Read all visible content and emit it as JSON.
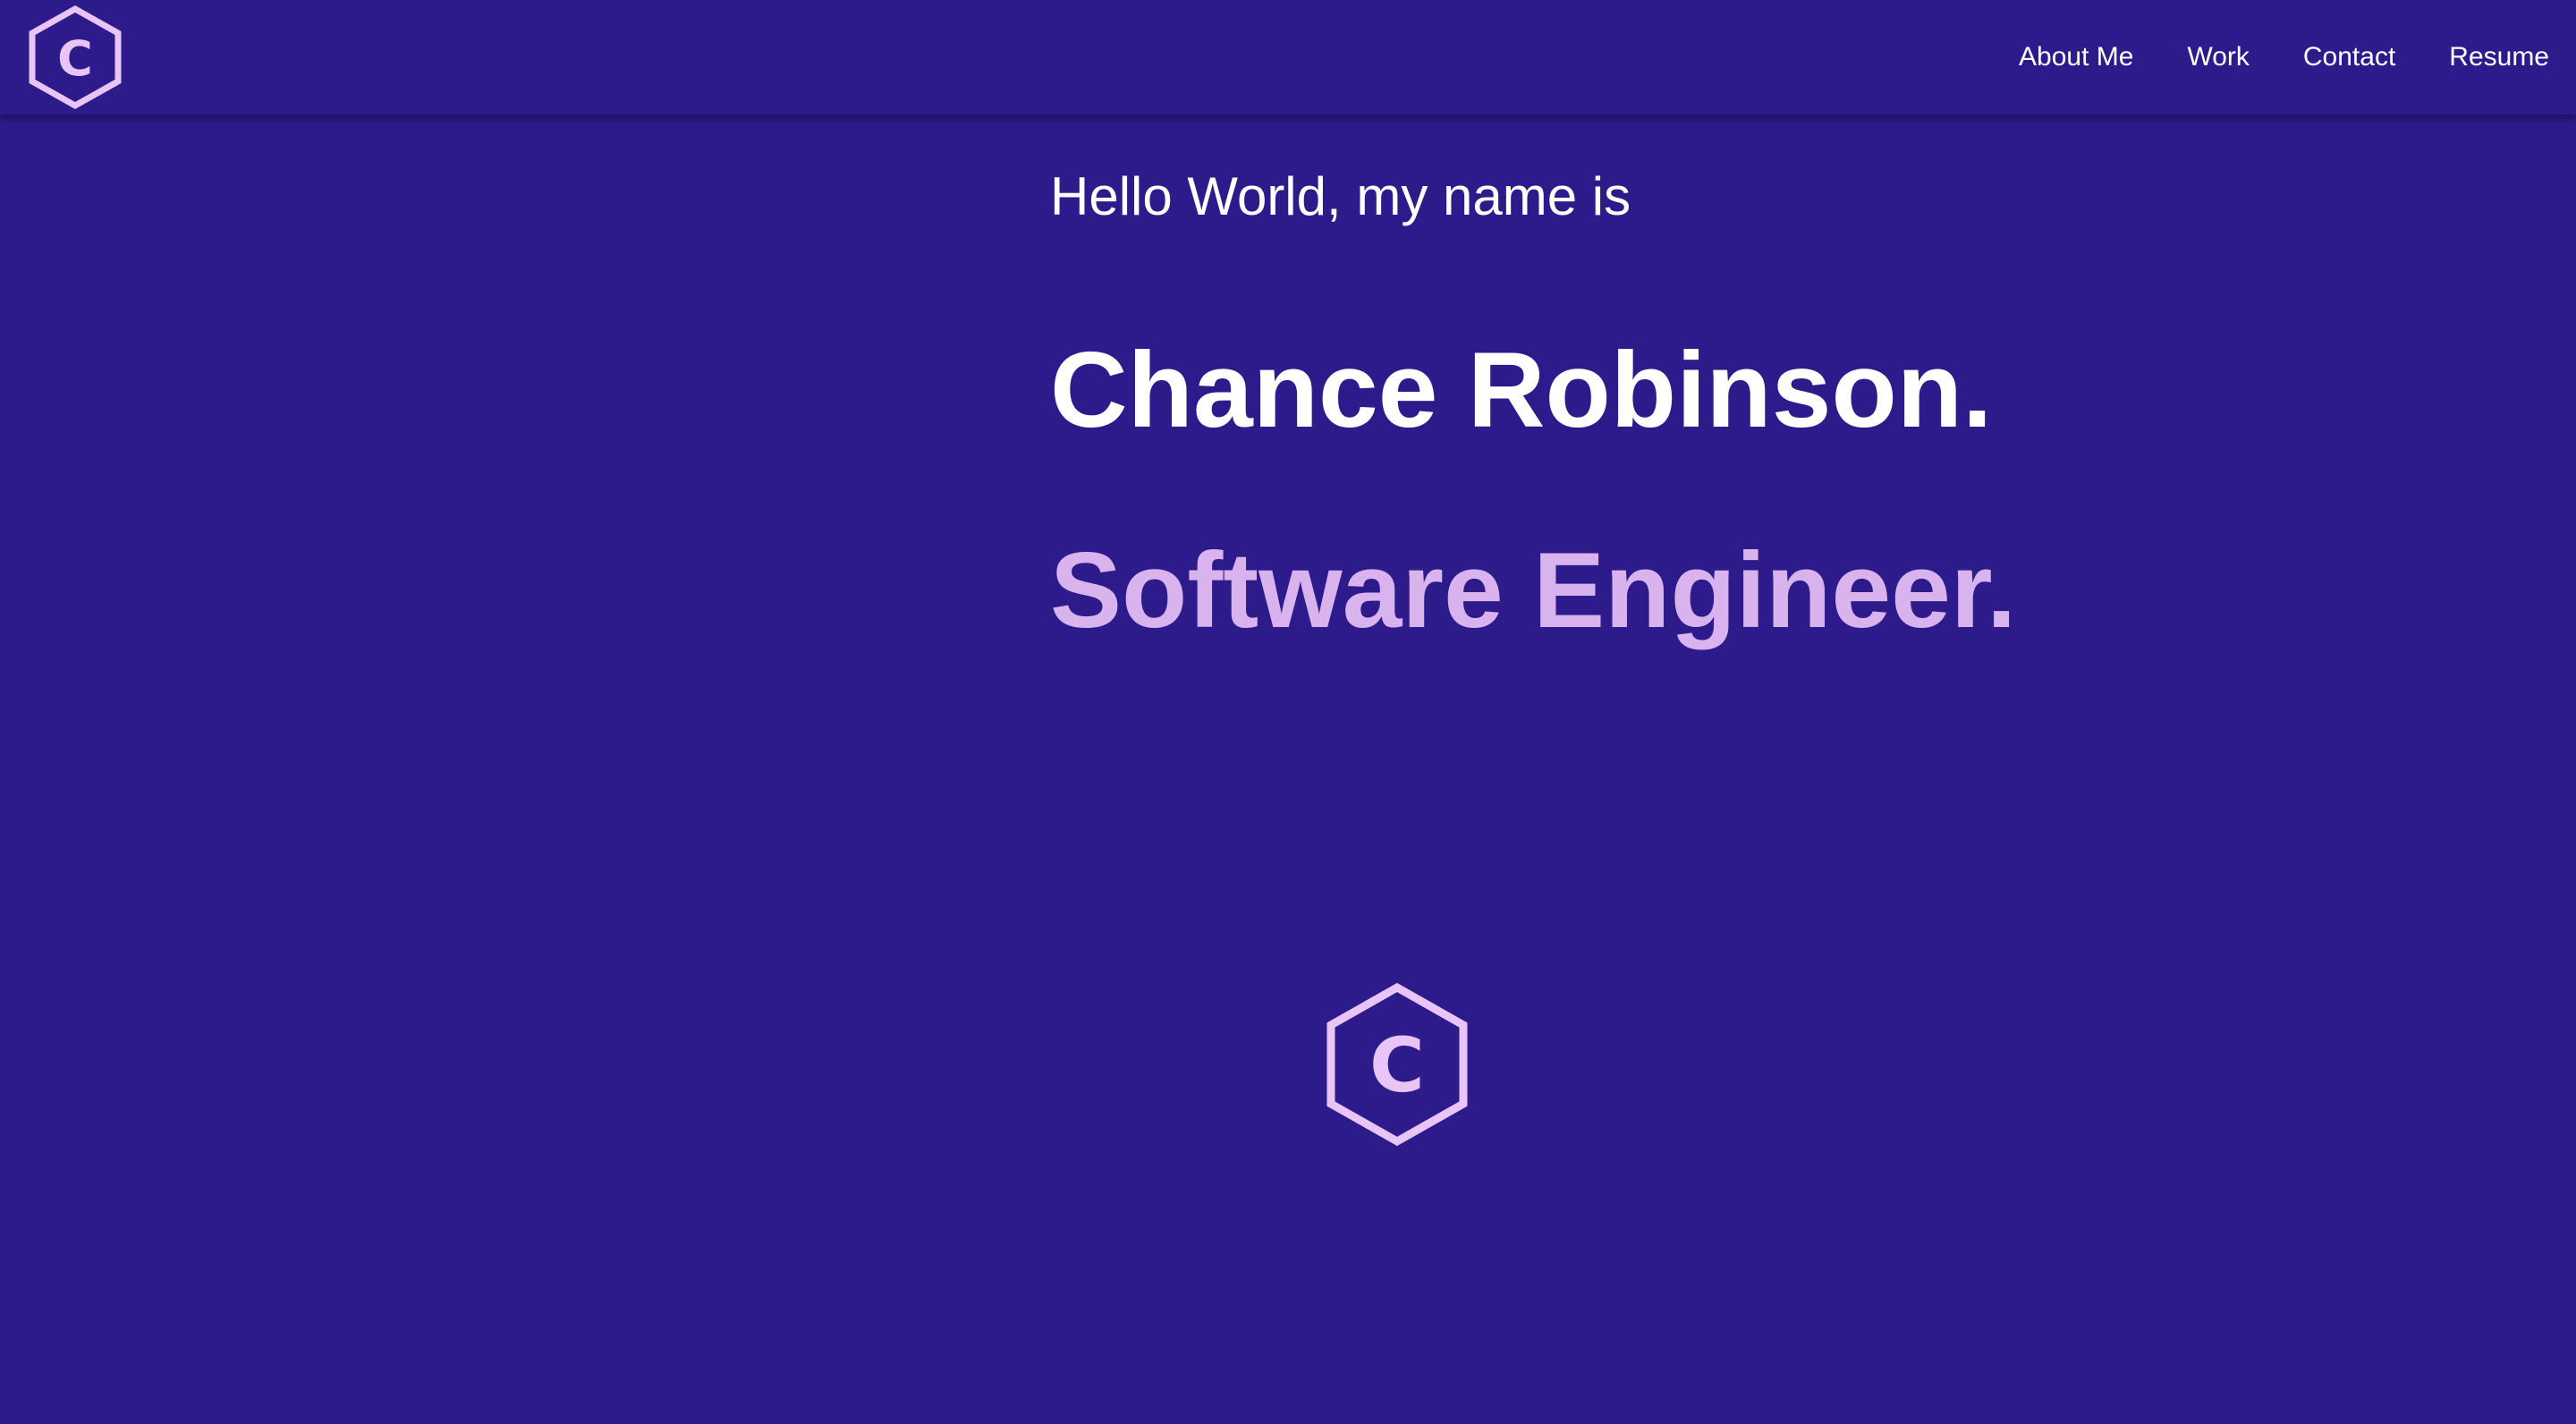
{
  "nav": {
    "logo_letter": "C",
    "links": [
      {
        "label": "About Me"
      },
      {
        "label": "Work"
      },
      {
        "label": "Contact"
      },
      {
        "label": "Resume"
      }
    ]
  },
  "hero": {
    "greeting": "Hello World, my name is",
    "name": "Chance Robinson.",
    "role": "Software Engineer."
  },
  "footer_logo": {
    "letter": "C"
  },
  "colors": {
    "background": "#2d1b8b",
    "text": "#ffffff",
    "accent": "#d9b3ee"
  },
  "icons": {
    "logo": "hexagon-c-logo-icon"
  }
}
